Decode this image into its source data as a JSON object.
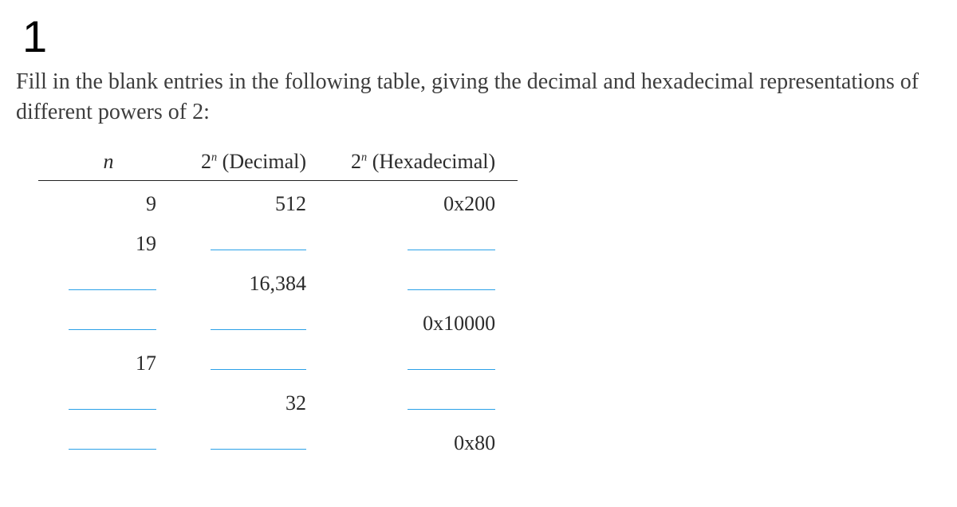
{
  "problem_number": "1",
  "prompt": "Fill in the blank entries in the following table, giving the decimal and hexadecimal representations of different powers of 2:",
  "headers": {
    "n_html": "<span class=\"ital\">n</span>",
    "dec_html": "2<span class=\"sup\">n</span> (Decimal)",
    "hex_html": "2<span class=\"sup\">n</span> (Hexadecimal)"
  },
  "rows": [
    {
      "n": "9",
      "dec": "512",
      "hex": "0x200"
    },
    {
      "n": "19",
      "dec": "",
      "hex": ""
    },
    {
      "n": "",
      "dec": "16,384",
      "hex": ""
    },
    {
      "n": "",
      "dec": "",
      "hex": "0x10000"
    },
    {
      "n": "17",
      "dec": "",
      "hex": ""
    },
    {
      "n": "",
      "dec": "32",
      "hex": ""
    },
    {
      "n": "",
      "dec": "",
      "hex": "0x80"
    }
  ],
  "chart_data": {
    "type": "table",
    "title": "Powers of 2 — decimal and hexadecimal",
    "columns": [
      "n",
      "2^n (Decimal)",
      "2^n (Hexadecimal)"
    ],
    "rows": [
      [
        "9",
        "512",
        "0x200"
      ],
      [
        "19",
        "",
        ""
      ],
      [
        "",
        "16,384",
        ""
      ],
      [
        "",
        "",
        "0x10000"
      ],
      [
        "17",
        "",
        ""
      ],
      [
        "",
        "32",
        ""
      ],
      [
        "",
        "",
        "0x80"
      ]
    ]
  }
}
